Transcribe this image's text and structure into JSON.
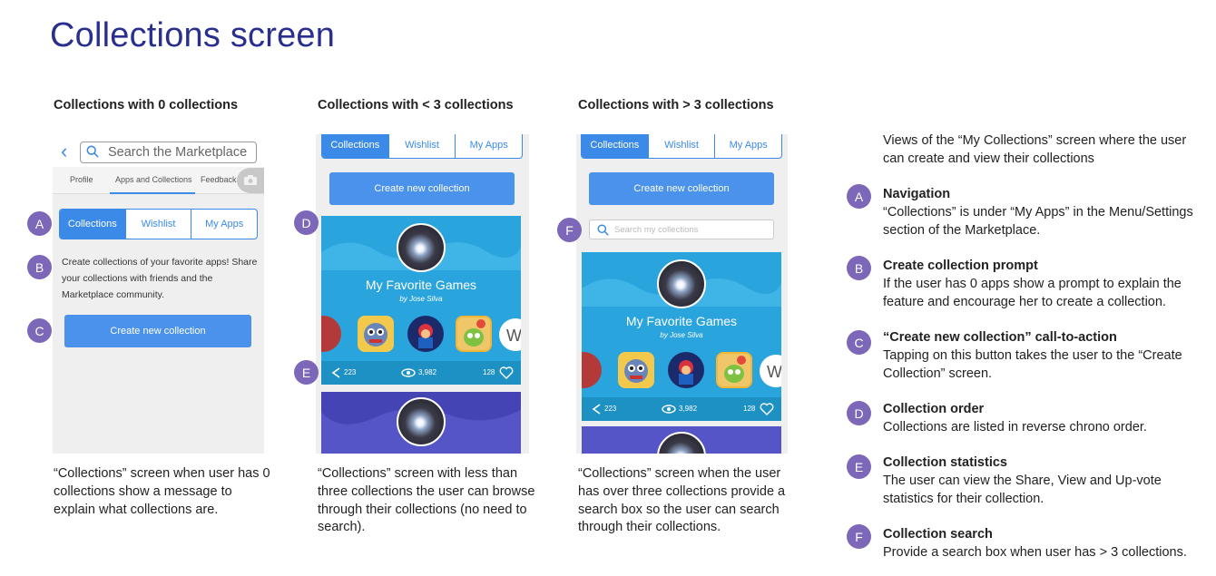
{
  "title": "Collections screen",
  "columns": [
    {
      "heading": "Collections with 0 collections",
      "caption": "“Collections” screen when user has 0 collections show a message to explain what collections are."
    },
    {
      "heading": "Collections with < 3 collections",
      "caption": "“Collections” screen with less than three collections the user can browse through their collections (no need to search)."
    },
    {
      "heading": "Collections with > 3 collections",
      "caption": "“Collections” screen when the user has over three collections provide a search box so the user can search through their collections."
    }
  ],
  "phone1": {
    "search_placeholder": "Search the Marketplace",
    "nav_tabs": [
      "Profile",
      "Apps and Collections",
      "Feedback"
    ],
    "prompt": "Create collections of your favorite apps! Share your collections with friends and the Marketplace community."
  },
  "segment_tabs": [
    "Collections",
    "Wishlist",
    "My Apps"
  ],
  "create_button": "Create new collection",
  "search_collections_placeholder": "Search my collections",
  "collection_card": {
    "title": "My Favorite Games",
    "author": "by Jose Silva",
    "shares": "223",
    "views": "3,982",
    "upvotes": "128"
  },
  "markers": [
    "A",
    "B",
    "C",
    "D",
    "E",
    "F"
  ],
  "description": {
    "intro": "Views of the “My Collections” screen where the user can create and view their collections",
    "items": [
      {
        "letter": "A",
        "title": "Navigation",
        "text": "“Collections” is under “My Apps” in the Menu/Settings section of the Marketplace."
      },
      {
        "letter": "B",
        "title": "Create collection prompt",
        "text": "If the user has 0 apps show a prompt to explain the feature and encourage her to create a collection."
      },
      {
        "letter": "C",
        "title": "“Create new collection” call-to-action",
        "text": "Tapping on this button takes the user to the “Create Collection” screen."
      },
      {
        "letter": "D",
        "title": "Collection order",
        "text": "Collections are listed in reverse chrono order."
      },
      {
        "letter": "E",
        "title": "Collection statistics",
        "text": "The user can view the Share, View and Up-vote statistics for their collection."
      },
      {
        "letter": "F",
        "title": "Collection search",
        "text": "Provide a search box when user has > 3 collections."
      }
    ]
  },
  "colors": {
    "title": "#2a2f8f",
    "accent_blue": "#3b8ae8",
    "card_blue": "#2aa4dc",
    "marker_purple": "#7d67b8"
  }
}
